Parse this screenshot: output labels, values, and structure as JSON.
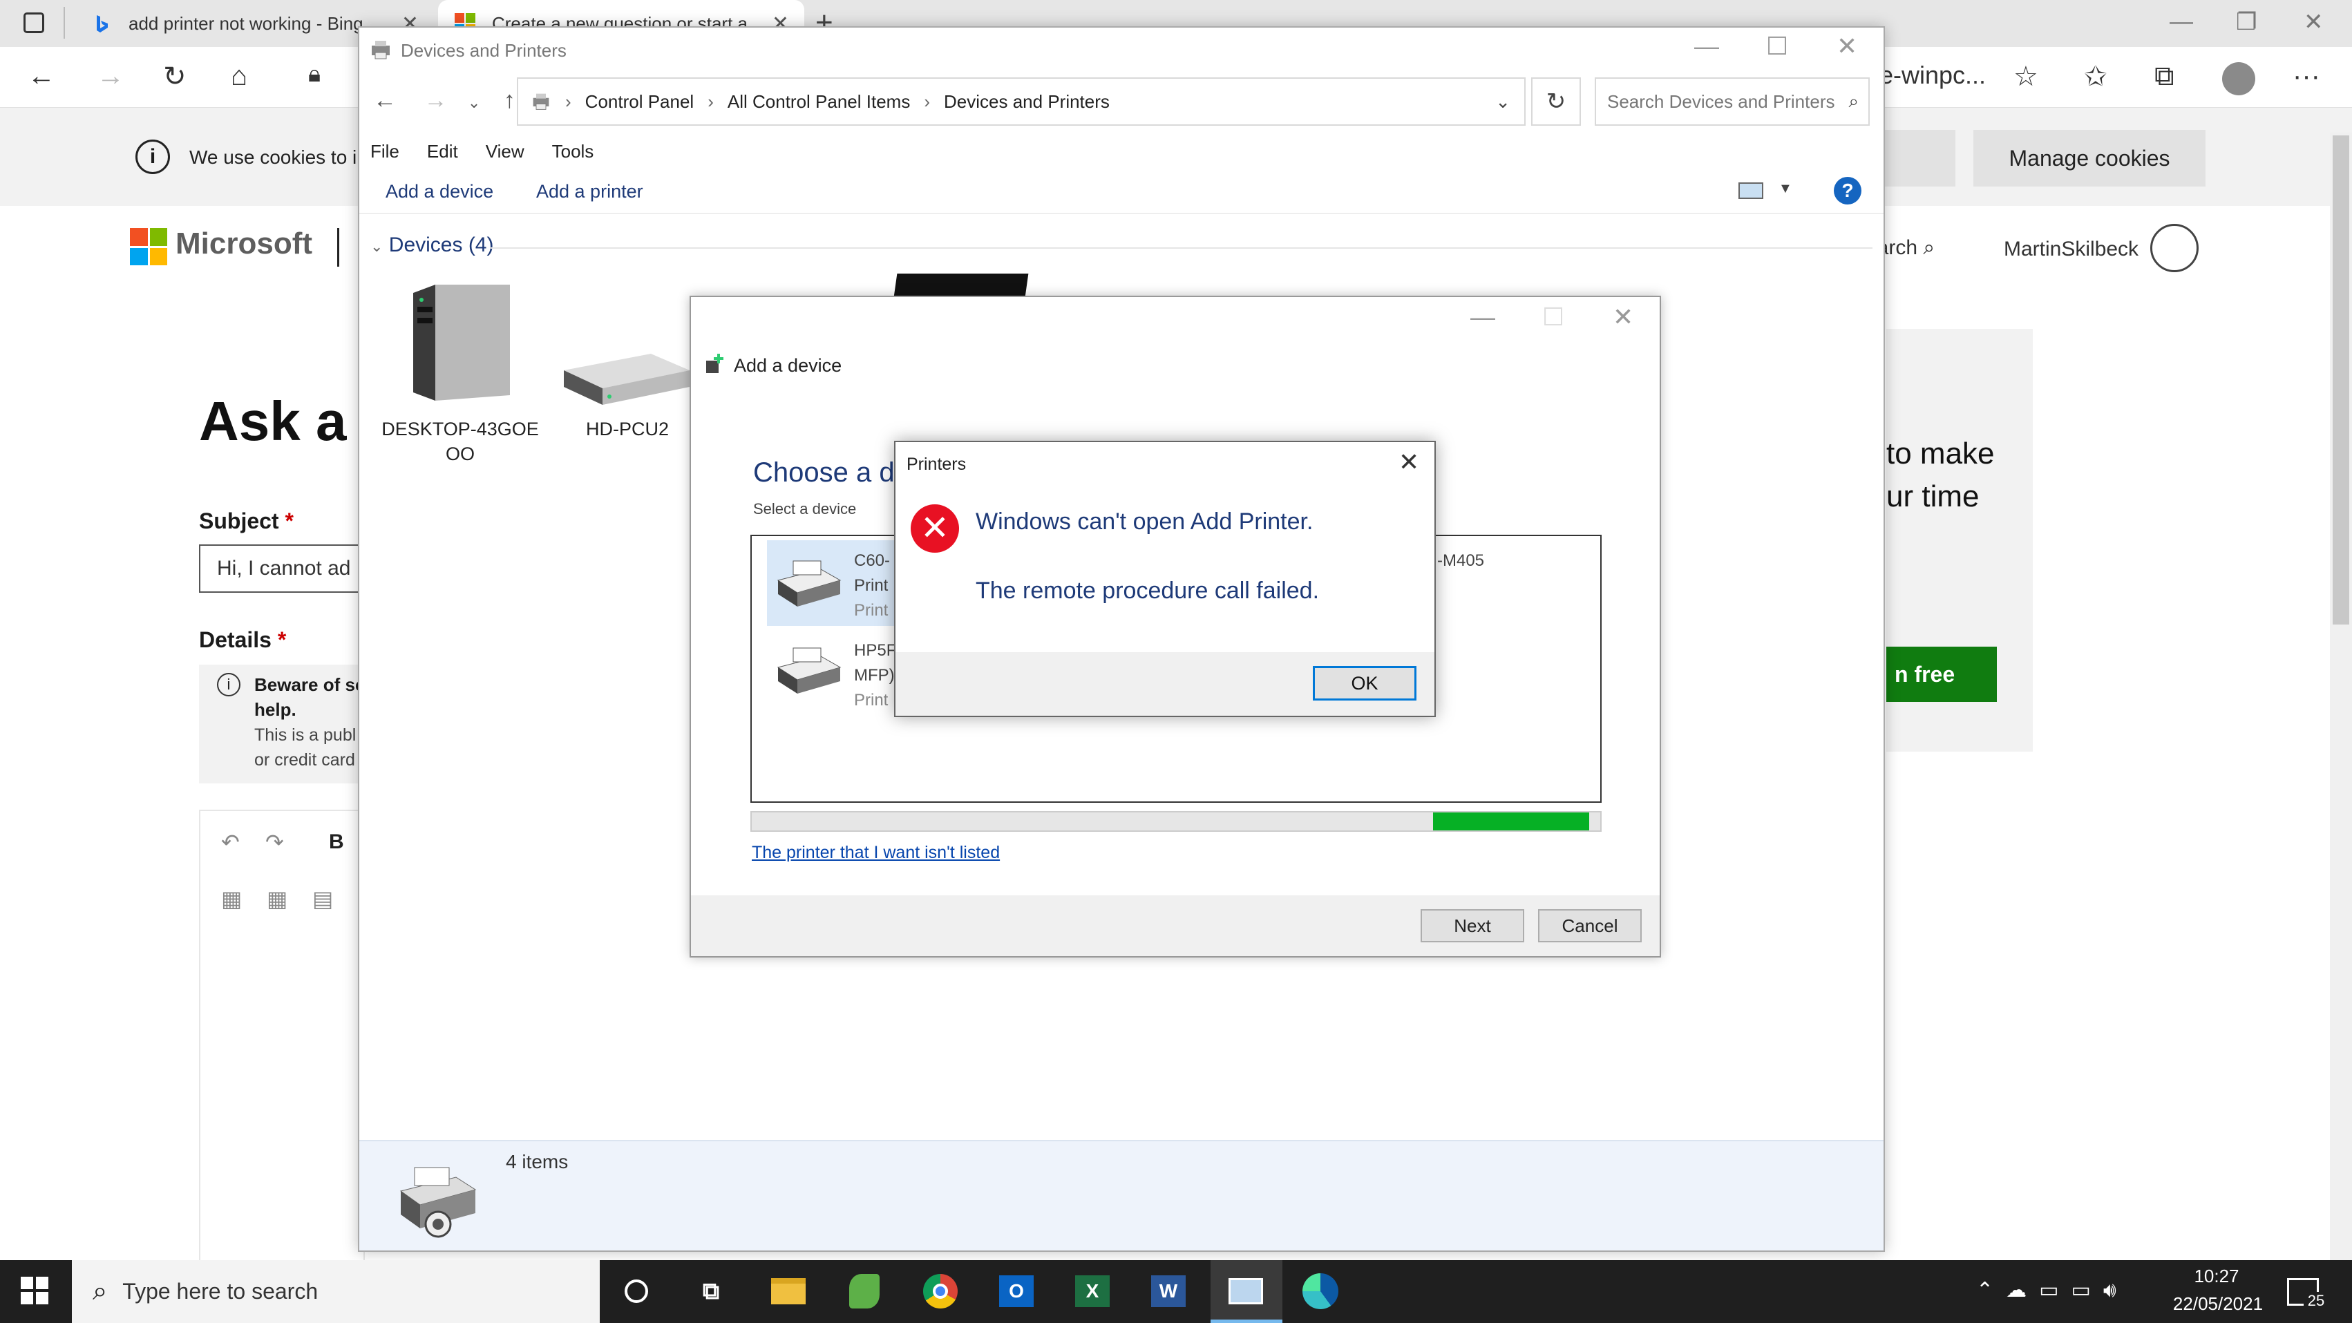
{
  "browser": {
    "tabs": [
      {
        "label": "add printer not working - Bing"
      },
      {
        "label": "Create a new question or start a..."
      }
    ],
    "new_tab_label": "+",
    "address_fragment": "e-winpc...",
    "cookie_text": "We use cookies to in",
    "cookie_manage": "Manage cookies"
  },
  "page": {
    "brand": "Microsoft",
    "search_label": "earch",
    "username": "MartinSkilbeck",
    "heading": "Ask a C",
    "subject_label": "Subject",
    "required_mark": "*",
    "subject_value": "Hi, I cannot ad",
    "details_label": "Details",
    "warning_line1": "Beware of sc",
    "warning_line2": "help.",
    "warning_line3": "This is a publ",
    "warning_line4": "or credit card",
    "editor_bold": "B",
    "promo_line1": "to make",
    "promo_line2": "ur time",
    "promo_button": "n free"
  },
  "devices_window": {
    "title": "Devices and Printers",
    "breadcrumb": [
      "Control Panel",
      "All Control Panel Items",
      "Devices and Printers"
    ],
    "search_placeholder": "Search Devices and Printers",
    "menu": [
      "File",
      "Edit",
      "View",
      "Tools"
    ],
    "toolbar": {
      "add_device": "Add a device",
      "add_printer": "Add a printer",
      "help": "?"
    },
    "devices_header": "Devices (4)",
    "devices": [
      {
        "line1": "DESKTOP-43GOE",
        "line2": "OO"
      },
      {
        "line1": "HD-PCU2",
        "line2": ""
      }
    ],
    "status_count": "4 items"
  },
  "add_device_dialog": {
    "title": "Add a device",
    "heading": "Choose a de",
    "subheading": "Select a device",
    "devices": [
      {
        "name": "C60-",
        "type1": "Print",
        "type2": "Print",
        "extra": "-M405"
      },
      {
        "name": "HP5F",
        "type1": "MFP)",
        "type2": "Print"
      }
    ],
    "progress": 0.15,
    "not_listed_link": "The printer that I want isn't listed",
    "next_button": "Next",
    "cancel_button": "Cancel"
  },
  "error_dialog": {
    "title": "Printers",
    "message1": "Windows can't open Add Printer.",
    "message2": "The remote procedure call failed.",
    "ok_button": "OK"
  },
  "taskbar": {
    "search_placeholder": "Type here to search",
    "time": "10:27",
    "date": "22/05/2021",
    "notifications": "25"
  },
  "colors": {
    "accent": "#0078d7",
    "error": "#e81123",
    "progress": "#06b025",
    "promo": "#107c10"
  }
}
